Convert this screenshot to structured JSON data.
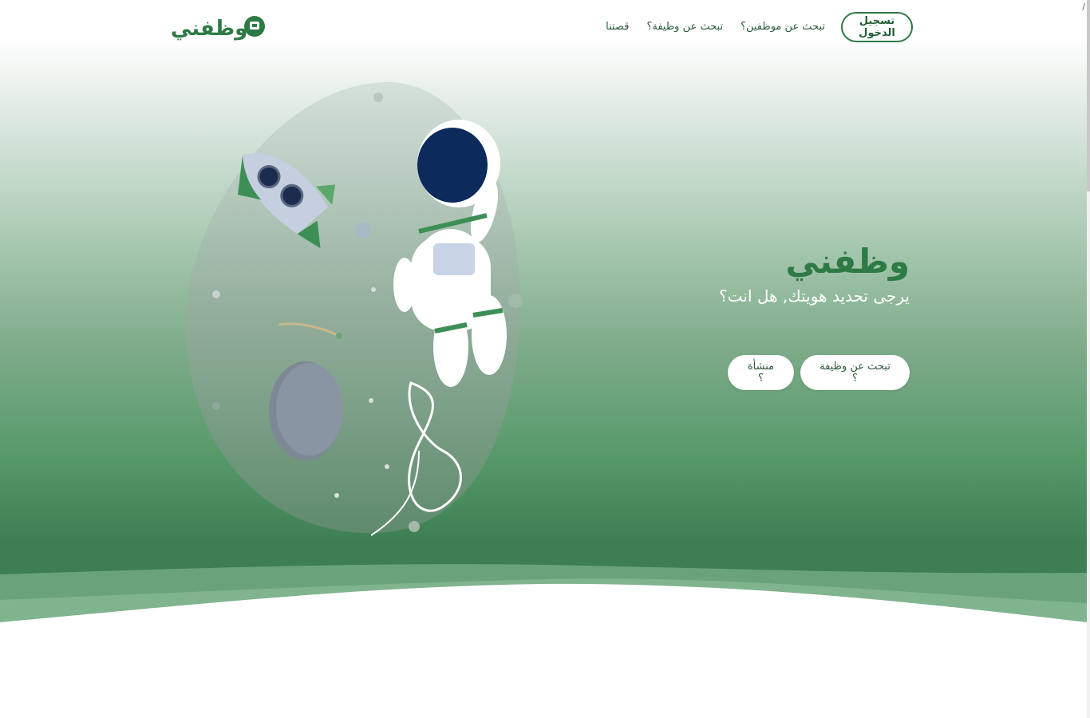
{
  "nav": {
    "logo_text": "وظفني",
    "links": [
      {
        "label": "تبحث عن موظفين؟"
      },
      {
        "label": "تبحث عن وظيفة؟"
      },
      {
        "label": "قصتنا"
      }
    ],
    "login_label": "تسجيل الدخول"
  },
  "hero": {
    "title": "وظفني",
    "subtitle": "يرجى تحديد هويتك, هل انت؟",
    "buttons": {
      "job_seeker": "تبحث عن وظيفة ؟",
      "company": "منشأة ؟"
    }
  },
  "corner_text": "/",
  "colors": {
    "brand_green": "#2e7a45",
    "dark_green": "#3d7f52",
    "white": "#ffffff"
  },
  "icons": [
    "logo-icon",
    "astronaut-illustration",
    "rocket-illustration",
    "planet-illustration"
  ]
}
